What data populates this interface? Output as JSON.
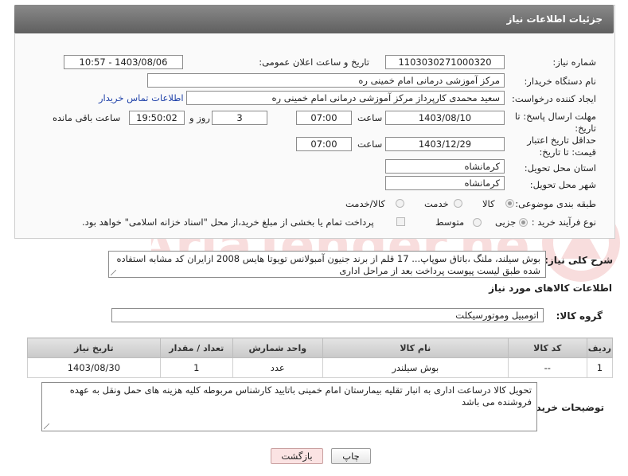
{
  "header": {
    "title": "جزئیات اطلاعات نیاز"
  },
  "form": {
    "need_number_label": "شماره نیاز:",
    "need_number": "1103030271000320",
    "announce_label": "تاریخ و ساعت اعلان عمومی:",
    "announce_value": "1403/08/06 - 10:57",
    "buyer_org_label": "نام دستگاه خریدار:",
    "buyer_org": "مرکز آموزشی درمانی امام خمینی ره",
    "creator_label": "ایجاد کننده درخواست:",
    "creator": "سعید محمدی کارپرداز مرکز آموزشی درمانی امام خمینی ره",
    "contact_link": "اطلاعات تماس خریدار",
    "deadline_label": "مهلت ارسال پاسخ: تا تاریخ:",
    "deadline_date": "1403/08/10",
    "time_label": "ساعت",
    "deadline_time": "07:00",
    "days_value": "3",
    "days_label": "روز و",
    "remaining_time": "19:50:02",
    "remaining_label": "ساعت باقی مانده",
    "validity_label": "حداقل تاریخ اعتبار قیمت: تا تاریخ:",
    "validity_date": "1403/12/29",
    "validity_time": "07:00",
    "province_label": "استان محل تحویل:",
    "province": "کرمانشاه",
    "city_label": "شهر محل تحویل:",
    "city": "کرمانشاه",
    "category_label": "طبقه بندی موضوعی:",
    "category_options": [
      "کالا",
      "خدمت",
      "کالا/خدمت"
    ],
    "process_label": "نوع فرآیند خرید :",
    "process_options": [
      "جزیی",
      "متوسط"
    ],
    "payment_note": "پرداخت تمام یا بخشی از مبلغ خرید،از محل \"اسناد خزانه اسلامی\" خواهد بود."
  },
  "summary": {
    "label": "شرح کلی نیاز:",
    "text": "بوش سیلند، ملنگ ،باتاق سوپاپ... 17 قلم از برند جنیون آمبولانس تویوتا هایس 2008 ازایران کد مشابه استفاده شده طبق لیست پیوست پرداخت بعد از مراحل اداری"
  },
  "goods": {
    "section_title": "اطلاعات کالاهای مورد نیاز",
    "group_label": "گروه کالا:",
    "group_value": "اتومبیل وموتورسیکلت",
    "columns": [
      "ردیف",
      "کد کالا",
      "نام کالا",
      "واحد شمارش",
      "تعداد / مقدار",
      "تاریخ نیاز"
    ],
    "rows": [
      {
        "row": "1",
        "code": "--",
        "name": "بوش سیلندر",
        "unit": "عدد",
        "qty": "1",
        "date": "1403/08/30"
      }
    ]
  },
  "buyer_notes": {
    "label": "توضیحات خریدار:",
    "text": "تحویل کالا درساعت اداری به انبار تقلیه بیمارستان امام خمینی باتایید کارشناس مربوطه کلیه هزینه های حمل ونقل به عهده فروشنده می باشد"
  },
  "buttons": {
    "print": "چاپ",
    "back": "بازگشت"
  },
  "watermark": {
    "text": "AriaTender.neT"
  },
  "colors": {
    "header": "#6e6e6e",
    "link": "#2244aa",
    "back_button": "#fbe3e3"
  }
}
